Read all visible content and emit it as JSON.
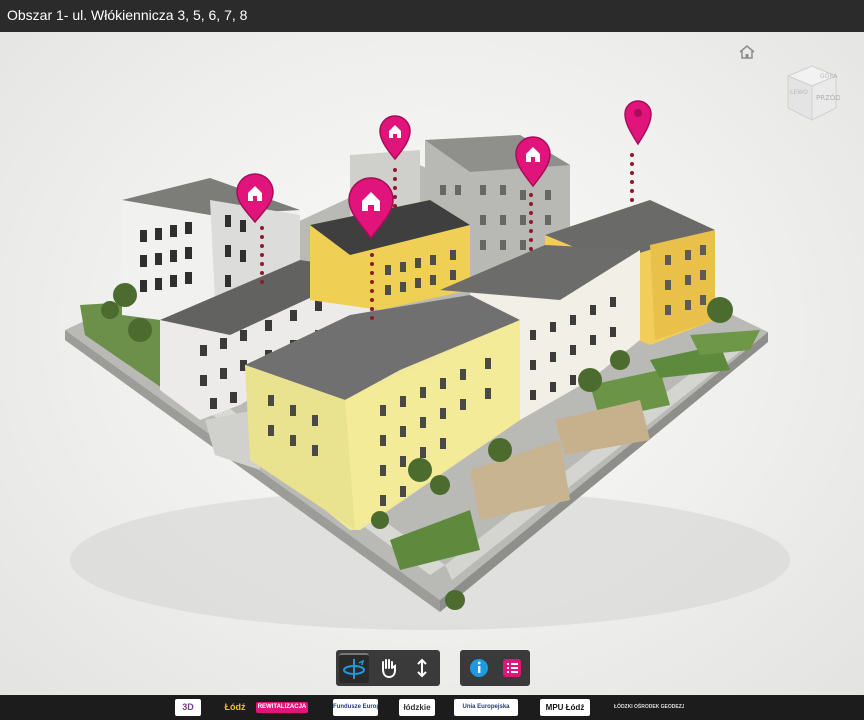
{
  "header": {
    "title": "Obszar 1- ul. Włókiennicza 3, 5, 6, 7, 8"
  },
  "navcube": {
    "face_top": "GÓRA",
    "face_front": "PRZÓD",
    "face_left": "LEWO"
  },
  "toolbar": {
    "tools": [
      {
        "icon": "orbit-icon",
        "active": true
      },
      {
        "icon": "pan-hand-icon",
        "active": false
      },
      {
        "icon": "zoom-arrows-icon",
        "active": false
      }
    ],
    "info": {
      "icon": "info-icon"
    },
    "list": {
      "icon": "list-icon"
    }
  },
  "pins": [
    {
      "icon": "house-pin-icon"
    },
    {
      "icon": "house-pin-icon"
    },
    {
      "icon": "house-pin-icon"
    },
    {
      "icon": "house-pin-icon"
    },
    {
      "icon": "pin-icon"
    }
  ],
  "footer": {
    "logos": [
      {
        "label": "3D"
      },
      {
        "label": "Łódź"
      },
      {
        "label": "REWITALIZACJA"
      },
      {
        "label": "Fundusze Europejskie"
      },
      {
        "label": "łódzkie"
      },
      {
        "label": "Unia Europejska"
      },
      {
        "label": "MPU Łódź"
      },
      {
        "label": "ŁÓDZKI OŚRODEK GEODEZJI"
      }
    ]
  },
  "colors": {
    "pin": "#e0147a",
    "accent_blue": "#1e9be0",
    "accent_pink": "#e0147a",
    "title_bg": "#2b2b2b"
  }
}
